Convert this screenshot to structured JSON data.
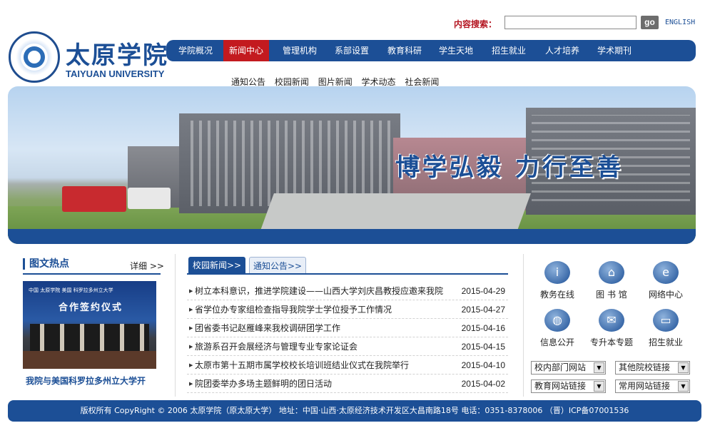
{
  "header": {
    "logo_cn": "太原学院",
    "logo_en": "TAIYUAN UNIVERSITY",
    "search_label": "内容搜索：",
    "search_value": "",
    "search_button": "go",
    "english_link": "ENGLISH"
  },
  "nav": {
    "items": [
      {
        "label": "学院概况"
      },
      {
        "label": "新闻中心",
        "active": true
      },
      {
        "label": "管理机构"
      },
      {
        "label": "系部设置"
      },
      {
        "label": "教育科研"
      },
      {
        "label": "学生天地"
      },
      {
        "label": "招生就业"
      },
      {
        "label": "人才培养"
      },
      {
        "label": "学术期刊"
      }
    ],
    "active_color": "#c31a1f",
    "bar_color": "#1c4f96"
  },
  "subnav": {
    "items": [
      "通知公告",
      "校园新闻",
      "图片新闻",
      "学术动态",
      "社会新闻"
    ]
  },
  "banner": {
    "motto": "博学弘毅  力行至善"
  },
  "hot": {
    "title": "图文热点",
    "more": "详细 >>",
    "photo_header": "中国 太原学院     美国 科罗拉多州立大学",
    "photo_sign": "合作签约仪式",
    "caption": "我院与美国科罗拉多州立大学开"
  },
  "news": {
    "tabs": [
      "校园新闻>>",
      "通知公告>>"
    ],
    "items": [
      {
        "title": "树立本科意识，推进学院建设——山西大学刘庆昌教授应邀来我院",
        "date": "2015-04-29"
      },
      {
        "title": "省学位办专家组检查指导我院学士学位授予工作情况",
        "date": "2015-04-27"
      },
      {
        "title": "团省委书记赵雁峰来我校调研团学工作",
        "date": "2015-04-16"
      },
      {
        "title": "旅游系召开会展经济与管理专业专家论证会",
        "date": "2015-04-15"
      },
      {
        "title": "太原市第十五期市属学校校长培训班结业仪式在我院举行",
        "date": "2015-04-10"
      },
      {
        "title": "院团委举办多场主题鲜明的团日活动",
        "date": "2015-04-02"
      }
    ]
  },
  "services": {
    "items": [
      {
        "label": "教务在线",
        "icon": "info-icon"
      },
      {
        "label": "图 书 馆",
        "icon": "library-icon"
      },
      {
        "label": "网络中心",
        "icon": "ie-icon"
      },
      {
        "label": "信息公开",
        "icon": "globe-icon"
      },
      {
        "label": "专升本专题",
        "icon": "mail-icon"
      },
      {
        "label": "招生就业",
        "icon": "monitor-icon"
      }
    ]
  },
  "links": {
    "selects": [
      "校内部门网站",
      "其他院校链接",
      "教育网站链接",
      "常用网站链接"
    ]
  },
  "footer": {
    "text": "版权所有 CopyRight © 2006 太原学院（原太原大学） 地址：中国·山西·太原经济技术开发区大昌南路18号 电话：0351-8378006 （晋）ICP备07001536"
  }
}
